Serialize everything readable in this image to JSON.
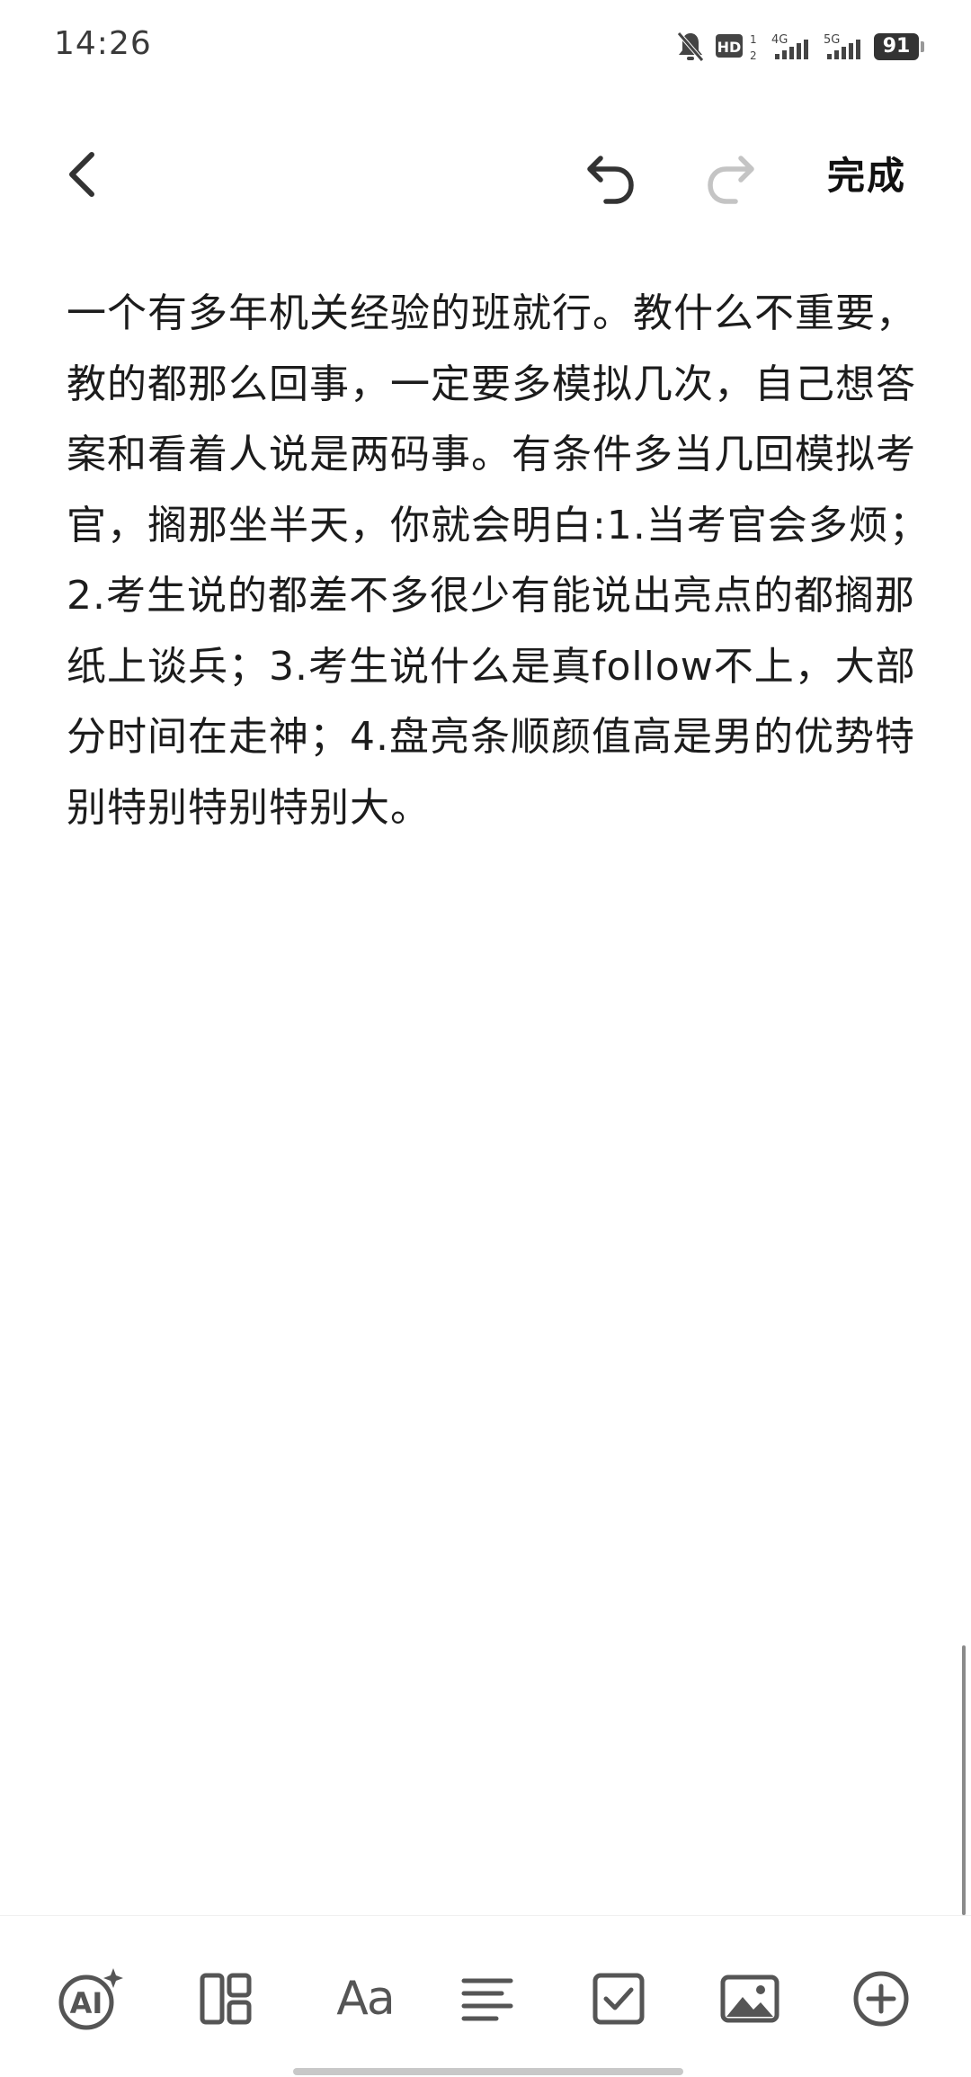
{
  "status_bar": {
    "time": "14:26",
    "battery_level": "91",
    "network_1": "4G",
    "network_2": "5G",
    "hd_badge": "HD",
    "icons": [
      "bell-muted-icon",
      "hd-icon",
      "signal-4g-icon",
      "signal-5g-icon",
      "battery-icon"
    ]
  },
  "toolbar": {
    "done_label": "完成",
    "icons": [
      "back-icon",
      "undo-icon",
      "redo-icon"
    ]
  },
  "note": {
    "body": "一个有多年机关经验的班就行。教什么不重要，教的都那么回事，一定要多模拟几次，自己想答案和看着人说是两码事。有条件多当几回模拟考官，搁那坐半天，你就会明白:1.当考官会多烦；2.考生说的都差不多很少有能说出亮点的都搁那纸上谈兵；3.考生说什么是真follow不上，大部分时间在走神；4.盘亮条顺颜值高是男的优势特别特别特别特别大。"
  },
  "bottom_tools": {
    "text_style_label": "Aa",
    "icons": [
      "ai-icon",
      "layout-icon",
      "text-style-icon",
      "align-icon",
      "checklist-icon",
      "image-icon",
      "add-icon"
    ]
  },
  "colors": {
    "icon_dark": "#333333",
    "icon_disabled": "#c4c4c4",
    "icon_tool": "#555555",
    "text": "#1c1c1c"
  }
}
